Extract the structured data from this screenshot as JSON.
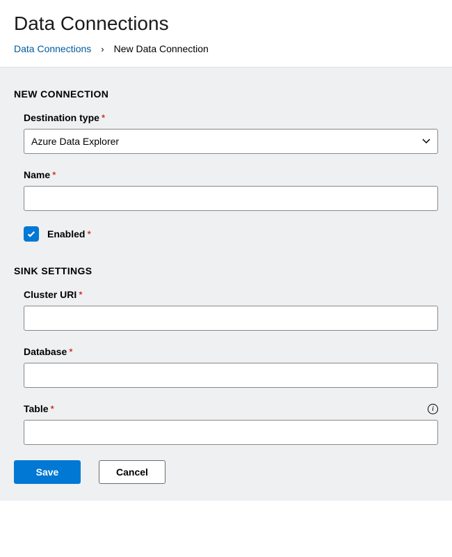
{
  "header": {
    "title": "Data Connections",
    "breadcrumb": {
      "root": "Data Connections",
      "current": "New Data Connection"
    }
  },
  "sections": {
    "new_connection": {
      "title": "NEW CONNECTION",
      "fields": {
        "destination_type": {
          "label": "Destination type",
          "value": "Azure Data Explorer"
        },
        "name": {
          "label": "Name",
          "value": ""
        },
        "enabled": {
          "label": "Enabled",
          "checked": true
        }
      }
    },
    "sink_settings": {
      "title": "SINK SETTINGS",
      "fields": {
        "cluster_uri": {
          "label": "Cluster URI",
          "value": ""
        },
        "database": {
          "label": "Database",
          "value": ""
        },
        "table": {
          "label": "Table",
          "value": ""
        }
      }
    }
  },
  "buttons": {
    "save": "Save",
    "cancel": "Cancel"
  }
}
